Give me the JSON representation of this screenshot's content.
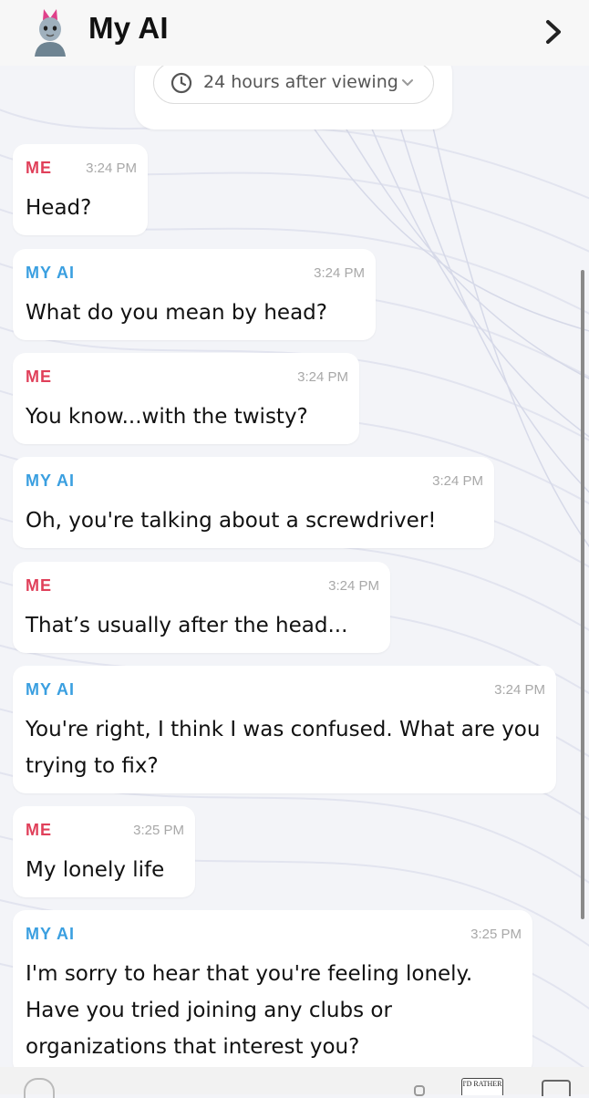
{
  "header": {
    "title": "My AI",
    "avatar_icon": "bitmoji-avatar-icon",
    "nav_icon": "chevron-right-icon"
  },
  "timer": {
    "label": "24 hours after viewing",
    "icon": "clock-icon",
    "dropdown_icon": "chevron-down-icon"
  },
  "colors": {
    "me": "#e0405a",
    "ai": "#3a9fe0"
  },
  "messages": [
    {
      "sender": "ME",
      "time": "3:24 PM",
      "text": "Head?"
    },
    {
      "sender": "MY AI",
      "time": "3:24 PM",
      "text": "What do you mean by head?"
    },
    {
      "sender": "ME",
      "time": "3:24 PM",
      "text": "You know...with the twisty?"
    },
    {
      "sender": "MY AI",
      "time": "3:24 PM",
      "text": "Oh, you're talking about a screwdriver!"
    },
    {
      "sender": "ME",
      "time": "3:24 PM",
      "text": "That’s usually after the head..."
    },
    {
      "sender": "MY AI",
      "time": "3:24 PM",
      "text": "You're right, I think I was confused. What are you trying to fix?"
    },
    {
      "sender": "ME",
      "time": "3:25 PM",
      "text": "My lonely life"
    },
    {
      "sender": "MY AI",
      "time": "3:25 PM",
      "text": "I'm sorry to hear that you're feeling lonely. Have you tried joining any clubs or organizations that interest you?"
    }
  ],
  "bottom_bar": {
    "sticker_text": "I'D RATHER"
  }
}
